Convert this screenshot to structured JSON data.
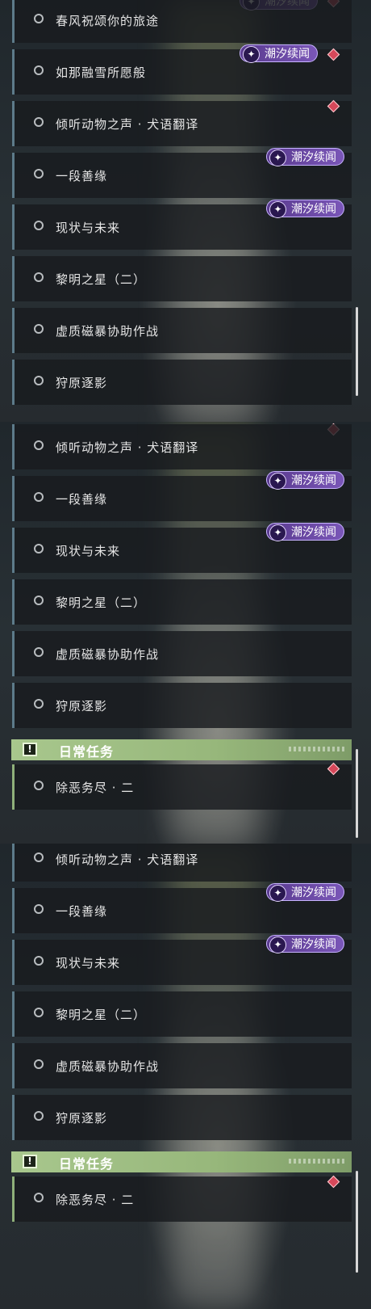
{
  "tags": {
    "tide_tales": "潮汐续闻",
    "tide_tales_partial": "潮汐续闻"
  },
  "sections": {
    "daily": "日常任务",
    "alert_glyph": "!"
  },
  "quests": {
    "q1": "春风祝颂你的旅途",
    "q2": "如那融雪所愿般",
    "q3": "倾听动物之声 · 犬语翻译",
    "q4": "一段善缘",
    "q5": "现状与未来",
    "q6": "黎明之星（二）",
    "q7": "虚质磁暴协助作战",
    "q8": "狩原逐影",
    "d1": "除恶务尽 · 二"
  },
  "colors": {
    "tag_purple": "#7a56b8",
    "daily_green": "#a8c78d",
    "marker_red": "#d6485a"
  }
}
